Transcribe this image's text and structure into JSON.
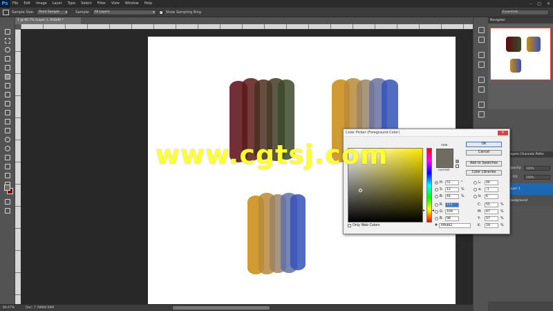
{
  "app": {
    "logo": "Ps"
  },
  "menu": [
    "File",
    "Edit",
    "Image",
    "Layer",
    "Type",
    "Select",
    "Filter",
    "View",
    "Window",
    "Help"
  ],
  "window_controls": {
    "minimize": "–",
    "maximize": "□",
    "close": "✕"
  },
  "options_bar": {
    "sample_size_label": "Sample Size:",
    "sample_size_value": "Point Sample",
    "sample_label": "Sample:",
    "sample_value": "All Layers",
    "show_ring_label": "Show Sampling Ring",
    "workspace": "Essentials"
  },
  "document": {
    "tab_title": "1 @ 66.7% (Layer 1, RGB/8) *"
  },
  "status": {
    "zoom": "66.67%",
    "doc_size": "Doc: 7.78M/8.06M"
  },
  "panels": {
    "navigator_title": "Navigator",
    "layers_tabs": "Layers   Channels   Paths",
    "opacity_label": "Opacity:",
    "opacity_value": "100%",
    "fill_label": "Fill:",
    "fill_value": "100%",
    "layers": [
      {
        "name": "Layer 1",
        "selected": true
      },
      {
        "name": "Background",
        "selected": false
      }
    ]
  },
  "color_picker": {
    "title": "Color Picker (Foreground Color)",
    "close": "✕",
    "new_label": "new",
    "current_label": "current",
    "buttons": {
      "ok": "OK",
      "cancel": "Cancel",
      "add_swatches": "Add to Swatches",
      "color_libraries": "Color Libraries"
    },
    "hsb": {
      "h_label": "H:",
      "h_value": "51",
      "h_unit": "°",
      "s_label": "S:",
      "s_value": "12",
      "s_unit": "%",
      "b_label": "B:",
      "b_value": "44",
      "b_unit": "%"
    },
    "rgb": {
      "r_label": "R:",
      "r_value": "111",
      "g_label": "G:",
      "g_value": "109",
      "b_label": "B:",
      "b_value": "98"
    },
    "lab": {
      "l_label": "L:",
      "l_value": "46",
      "a_label": "a:",
      "a_value": "-1",
      "b_label": "b:",
      "b_value": "6"
    },
    "cmyk": {
      "c_label": "C:",
      "c_value": "55",
      "c_unit": "%",
      "m_label": "M:",
      "m_value": "47",
      "m_unit": "%",
      "y_label": "Y:",
      "y_value": "57",
      "y_unit": "%",
      "k_label": "K:",
      "k_value": "19",
      "k_unit": "%"
    },
    "hex_label": "#",
    "hex_value": "6f6d62",
    "only_web_colors": "Only Web Colors",
    "colors": {
      "new": "#6f6d62",
      "current": "#6f6d62"
    }
  },
  "watermark": "www.cgtsj.com",
  "colors": {
    "foreground": "#6f6d62",
    "background": "#8b0000",
    "paint_dark_red": "#5a0a14",
    "paint_dark_green": "#3b4a2a",
    "paint_ochre": "#c98a0f",
    "paint_blue": "#3552b8"
  }
}
